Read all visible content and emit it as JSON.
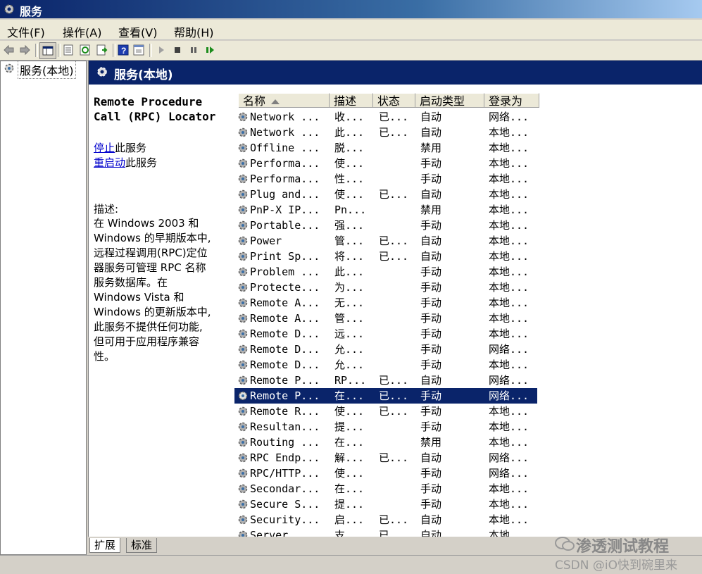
{
  "window": {
    "title": "服务"
  },
  "menu": [
    "文件(F)",
    "操作(A)",
    "查看(V)",
    "帮助(H)"
  ],
  "tree": {
    "item": "服务(本地)"
  },
  "header": {
    "title": "服务(本地)"
  },
  "description_pane": {
    "service_name_lines": [
      "Remote Procedure",
      "Call (RPC) Locator"
    ],
    "stop_link": "停止",
    "stop_suffix": "此服务",
    "restart_link": "重启动",
    "restart_suffix": "此服务",
    "desc_label": "描述:",
    "desc_lines": [
      "在 Windows 2003 和",
      "Windows 的早期版本中,",
      "远程过程调用(RPC)定位",
      "器服务可管理 RPC 名称",
      "服务数据库。在",
      "Windows Vista 和",
      "Windows 的更新版本中,",
      "此服务不提供任何功能,",
      "但可用于应用程序兼容",
      "性。"
    ]
  },
  "columns": {
    "name": "名称",
    "desc": "描述",
    "state": "状态",
    "type": "启动类型",
    "logon": "登录为"
  },
  "rows": [
    {
      "name": "Network ...",
      "desc": "收...",
      "state": "已...",
      "type": "自动",
      "logon": "网络..."
    },
    {
      "name": "Network ...",
      "desc": "此...",
      "state": "已...",
      "type": "自动",
      "logon": "本地..."
    },
    {
      "name": "Offline ...",
      "desc": "脱...",
      "state": "",
      "type": "禁用",
      "logon": "本地..."
    },
    {
      "name": "Performa...",
      "desc": "使...",
      "state": "",
      "type": "手动",
      "logon": "本地..."
    },
    {
      "name": "Performa...",
      "desc": "性...",
      "state": "",
      "type": "手动",
      "logon": "本地..."
    },
    {
      "name": "Plug and...",
      "desc": "使...",
      "state": "已...",
      "type": "自动",
      "logon": "本地..."
    },
    {
      "name": "PnP-X IP...",
      "desc": "Pn...",
      "state": "",
      "type": "禁用",
      "logon": "本地..."
    },
    {
      "name": "Portable...",
      "desc": "强...",
      "state": "",
      "type": "手动",
      "logon": "本地..."
    },
    {
      "name": "Power",
      "desc": "管...",
      "state": "已...",
      "type": "自动",
      "logon": "本地..."
    },
    {
      "name": "Print Sp...",
      "desc": "将...",
      "state": "已...",
      "type": "自动",
      "logon": "本地..."
    },
    {
      "name": "Problem ...",
      "desc": "此...",
      "state": "",
      "type": "手动",
      "logon": "本地..."
    },
    {
      "name": "Protecte...",
      "desc": "为...",
      "state": "",
      "type": "手动",
      "logon": "本地..."
    },
    {
      "name": "Remote A...",
      "desc": "无...",
      "state": "",
      "type": "手动",
      "logon": "本地..."
    },
    {
      "name": "Remote A...",
      "desc": "管...",
      "state": "",
      "type": "手动",
      "logon": "本地..."
    },
    {
      "name": "Remote D...",
      "desc": "远...",
      "state": "",
      "type": "手动",
      "logon": "本地..."
    },
    {
      "name": "Remote D...",
      "desc": "允...",
      "state": "",
      "type": "手动",
      "logon": "网络..."
    },
    {
      "name": "Remote D...",
      "desc": "允...",
      "state": "",
      "type": "手动",
      "logon": "本地..."
    },
    {
      "name": "Remote P...",
      "desc": "RP...",
      "state": "已...",
      "type": "自动",
      "logon": "网络..."
    },
    {
      "name": "Remote P...",
      "desc": "在...",
      "state": "已...",
      "type": "手动",
      "logon": "网络...",
      "selected": true
    },
    {
      "name": "Remote R...",
      "desc": "使...",
      "state": "已...",
      "type": "手动",
      "logon": "本地..."
    },
    {
      "name": "Resultan...",
      "desc": "提...",
      "state": "",
      "type": "手动",
      "logon": "本地..."
    },
    {
      "name": "Routing ...",
      "desc": "在...",
      "state": "",
      "type": "禁用",
      "logon": "本地..."
    },
    {
      "name": "RPC Endp...",
      "desc": "解...",
      "state": "已...",
      "type": "自动",
      "logon": "网络..."
    },
    {
      "name": "RPC/HTTP...",
      "desc": "使...",
      "state": "",
      "type": "手动",
      "logon": "网络..."
    },
    {
      "name": "Secondar...",
      "desc": "在...",
      "state": "",
      "type": "手动",
      "logon": "本地..."
    },
    {
      "name": "Secure S...",
      "desc": "提...",
      "state": "",
      "type": "手动",
      "logon": "本地..."
    },
    {
      "name": "Security...",
      "desc": "启...",
      "state": "已...",
      "type": "自动",
      "logon": "本地..."
    },
    {
      "name": "Server",
      "desc": "支...",
      "state": "已...",
      "type": "自动",
      "logon": "本地..."
    }
  ],
  "tabs": [
    "扩展",
    "标准"
  ],
  "watermark": {
    "line1": "渗透测试教程",
    "line2": "CSDN @iO快到碗里来"
  }
}
